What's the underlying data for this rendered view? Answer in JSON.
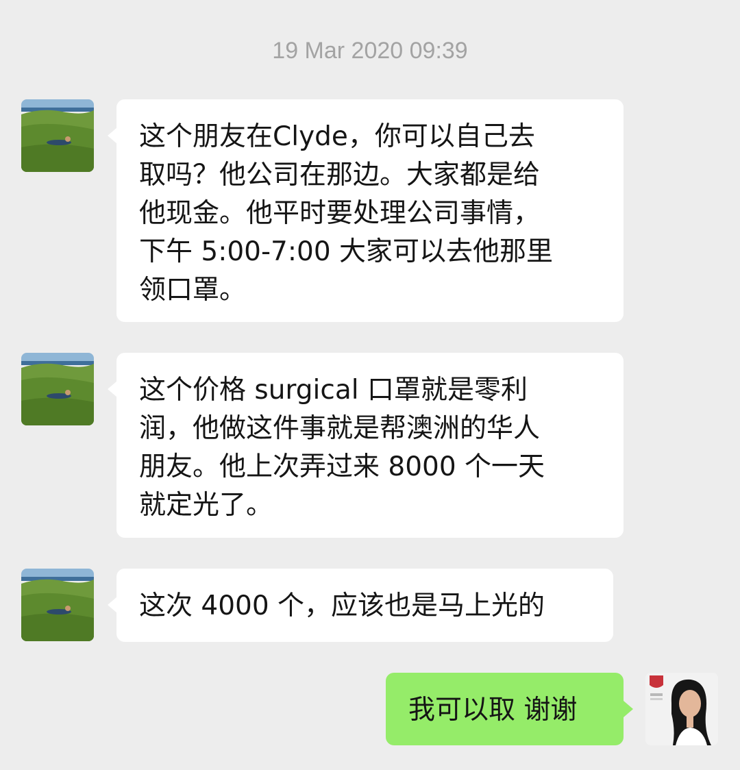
{
  "chat": {
    "timestamp": "19 Mar 2020 09:39",
    "messages": [
      {
        "sender": "contact",
        "avatar_icon": "beach-landscape-avatar-icon",
        "text": "这个朋友在Clyde，你可以自己去\n取吗？他公司在那边。大家都是给\n他现金。他平时要处理公司事情，\n下午 5:00-7:00 大家可以去他那里\n领口罩。"
      },
      {
        "sender": "contact",
        "avatar_icon": "beach-landscape-avatar-icon",
        "text": "这个价格 surgical 口罩就是零利\n润，他做这件事就是帮澳洲的华人\n朋友。他上次弄过来 8000 个一天\n就定光了。"
      },
      {
        "sender": "contact",
        "avatar_icon": "beach-landscape-avatar-icon",
        "text": "这次 4000 个，应该也是马上光的"
      },
      {
        "sender": "me",
        "avatar_icon": "woman-portrait-avatar-icon",
        "text": "我可以取 谢谢"
      }
    ]
  },
  "colors": {
    "background": "#ededed",
    "incoming_bubble": "#ffffff",
    "outgoing_bubble": "#95ec69",
    "timestamp_text": "#a3a3a3",
    "message_text": "#151515"
  }
}
